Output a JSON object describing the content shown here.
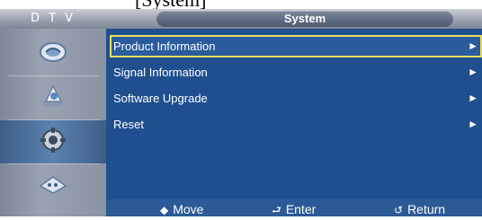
{
  "top_strip": {
    "text": "[System]"
  },
  "header": {
    "source_label": "D T V",
    "title": "System"
  },
  "sidebar": {
    "items": [
      {
        "icon": "picture-icon"
      },
      {
        "icon": "sound-icon"
      },
      {
        "icon": "setup-gear-icon",
        "selected": true
      },
      {
        "icon": "input-icon"
      }
    ]
  },
  "menu": {
    "items": [
      {
        "label": "Product Information",
        "arrow": "►",
        "highlighted": true
      },
      {
        "label": "Signal Information",
        "arrow": "►"
      },
      {
        "label": "Software Upgrade",
        "arrow": "►"
      },
      {
        "label": "Reset",
        "arrow": "►"
      }
    ]
  },
  "footer": {
    "move": {
      "icon": "◆",
      "label": "Move"
    },
    "enter": {
      "icon": "⮐",
      "label": "Enter"
    },
    "return": {
      "icon": "↺",
      "label": "Return"
    }
  },
  "colors": {
    "main_bg": "#1f4f8e",
    "highlight_border": "#e4e061",
    "sidebar_selected": "#4a6f99"
  }
}
